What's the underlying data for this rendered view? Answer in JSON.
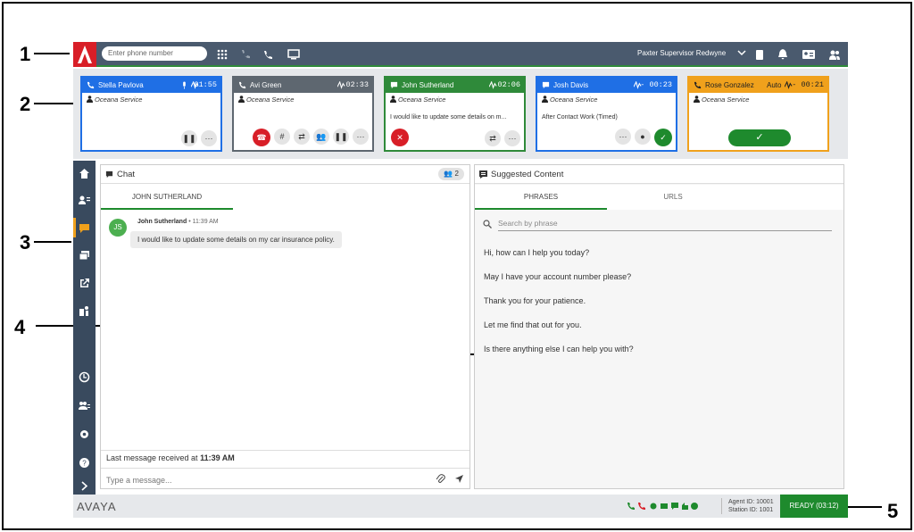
{
  "callouts": [
    "1",
    "2",
    "3",
    "4",
    "5"
  ],
  "topbar": {
    "phone_placeholder": "Enter phone number",
    "supervisor": "Paxter Supervisor Redwyne"
  },
  "cards": [
    {
      "name": "Stella Pavlova",
      "time": "01:55",
      "service": "Oceana Service",
      "message": "",
      "color": "#1f6fe5"
    },
    {
      "name": "Avi Green",
      "time": "02:33",
      "service": "Oceana Service",
      "message": "",
      "color": "#5e6770"
    },
    {
      "name": "John Sutherland",
      "time": "02:06",
      "service": "Oceana Service",
      "message": "I would like to update some details on m...",
      "color": "#2f8a3a"
    },
    {
      "name": "Josh Davis",
      "time": "- 00:23",
      "service": "Oceana Service",
      "message": "After Contact Work (Timed)",
      "color": "#1f6fe5"
    },
    {
      "name": "Rose Gonzalez",
      "time": "Auto",
      "time2": "- 00:21",
      "service": "Oceana Service",
      "message": "",
      "color": "#f0a11c"
    }
  ],
  "chat": {
    "title": "Chat",
    "participants": "2",
    "tab": "JOHN SUTHERLAND",
    "avatar": "JS",
    "sender": "John Sutherland",
    "timestamp": "• 11:39 AM",
    "message": "I would like to update some details on my car insurance policy.",
    "last_label": "Last message received at",
    "last_time": "11:39 AM",
    "input_placeholder": "Type a message..."
  },
  "suggested": {
    "title": "Suggested Content",
    "tab_phrases": "PHRASES",
    "tab_urls": "URLS",
    "search_placeholder": "Search by phrase",
    "phrases": [
      "Hi, how can I help you today?",
      "May I have your account number please?",
      "Thank you for your patience.",
      "Let me find that out for you.",
      "Is there anything else I can help you with?"
    ]
  },
  "footer": {
    "brand": "AVAYA",
    "agent_id": "Agent ID: 10001",
    "station_id": "Station ID: 1001",
    "status": "READY (03:12)"
  }
}
